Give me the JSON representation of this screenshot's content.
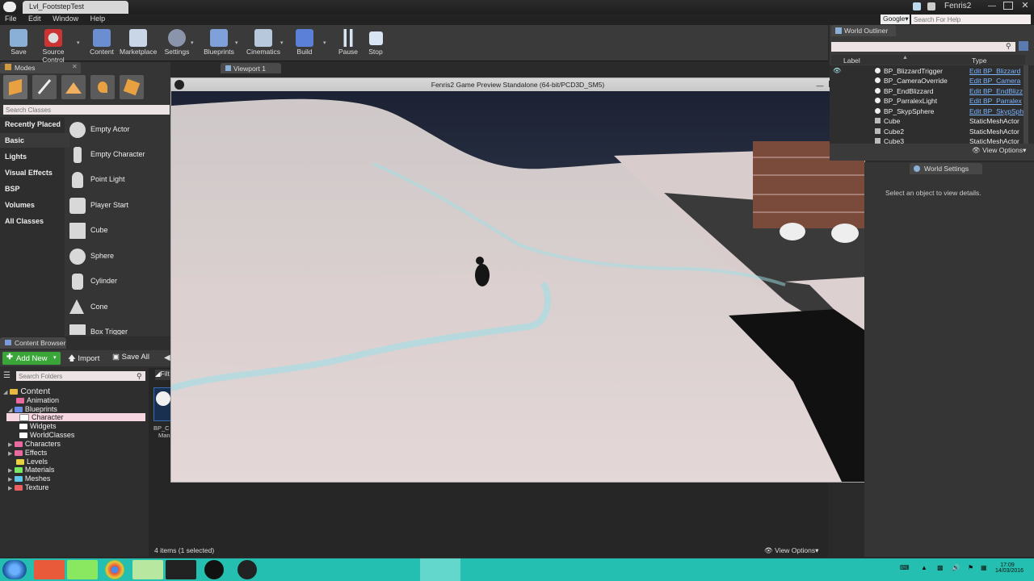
{
  "window": {
    "tab_title": "Lvl_FootstepTest",
    "app_title": "Fenris2",
    "search_provider": "Google",
    "help_search_placeholder": "Search For Help"
  },
  "menu": [
    "File",
    "Edit",
    "Window",
    "Help"
  ],
  "toolbar": [
    {
      "label": "Save",
      "icon": "save-icon"
    },
    {
      "label": "Source Control",
      "icon": "source-control-icon"
    },
    {
      "label": "Content",
      "icon": "content-icon"
    },
    {
      "label": "Marketplace",
      "icon": "marketplace-icon"
    },
    {
      "label": "Settings",
      "icon": "settings-icon"
    },
    {
      "label": "Blueprints",
      "icon": "blueprints-icon"
    },
    {
      "label": "Cinematics",
      "icon": "cinematics-icon"
    },
    {
      "label": "Build",
      "icon": "build-icon"
    },
    {
      "label": "Pause",
      "icon": "pause-icon"
    },
    {
      "label": "Stop",
      "icon": "stop-icon"
    }
  ],
  "modes": {
    "tab": "Modes",
    "search_placeholder": "Search Classes",
    "categories": [
      "Recently Placed",
      "Basic",
      "Lights",
      "Visual Effects",
      "BSP",
      "Volumes",
      "All Classes"
    ],
    "items": [
      "Empty Actor",
      "Empty Character",
      "Point Light",
      "Player Start",
      "Cube",
      "Sphere",
      "Cylinder",
      "Cone",
      "Box Trigger"
    ]
  },
  "viewport": {
    "tab": "Viewport 1",
    "game_title": "Fenris2 Game Preview Standalone (64-bit/PCD3D_SM5)"
  },
  "content_browser": {
    "tab": "Content Browser",
    "add_new": "Add New",
    "import": "Import",
    "save_all": "Save All",
    "search_placeholder": "Search Folders",
    "filters": "Filt",
    "tree": [
      {
        "label": "Content",
        "depth": 0,
        "color": "#e8b940"
      },
      {
        "label": "Animation",
        "depth": 1,
        "color": "#e86ba0"
      },
      {
        "label": "Blueprints",
        "depth": 1,
        "color": "#6a8ee8"
      },
      {
        "label": "Character",
        "depth": 2,
        "color": "#ffffff"
      },
      {
        "label": "Widgets",
        "depth": 2,
        "color": "#ffffff"
      },
      {
        "label": "WorldClasses",
        "depth": 2,
        "color": "#ffffff"
      },
      {
        "label": "Characters",
        "depth": 1,
        "color": "#e86ba0"
      },
      {
        "label": "Effects",
        "depth": 1,
        "color": "#e86ba0"
      },
      {
        "label": "Levels",
        "depth": 1,
        "color": "#e8d040"
      },
      {
        "label": "Materials",
        "depth": 1,
        "color": "#7ae860"
      },
      {
        "label": "Meshes",
        "depth": 1,
        "color": "#60c8e8"
      },
      {
        "label": "Texture",
        "depth": 1,
        "color": "#e86060"
      }
    ],
    "asset_label_1": "BP_C",
    "asset_label_2": "Man",
    "status": "4 items (1 selected)",
    "view_options": "View Options"
  },
  "world_outliner": {
    "tab": "World Outliner",
    "col_label": "Label",
    "col_type": "Type",
    "rows": [
      {
        "label": "BP_BlizzardTrigger",
        "type": "Edit BP_Blizzard",
        "link": true
      },
      {
        "label": "BP_CameraOverride",
        "type": "Edit BP_Camera",
        "link": true
      },
      {
        "label": "BP_EndBlizzard",
        "type": "Edit BP_EndBlizz",
        "link": true
      },
      {
        "label": "BP_ParralexLight",
        "type": "Edit BP_Parralex",
        "link": true
      },
      {
        "label": "BP_SkypSphere",
        "type": "Edit BP_SkypSph",
        "link": true
      },
      {
        "label": "Cube",
        "type": "StaticMeshActor",
        "link": false
      },
      {
        "label": "Cube2",
        "type": "StaticMeshActor",
        "link": false
      },
      {
        "label": "Cube3",
        "type": "StaticMeshActor",
        "link": false
      }
    ],
    "view_options": "View Options"
  },
  "world_settings": {
    "tab": "World Settings",
    "empty_msg": "Select an object to view details."
  },
  "taskbar": {
    "time": "17:09",
    "date": "14/03/2016"
  }
}
